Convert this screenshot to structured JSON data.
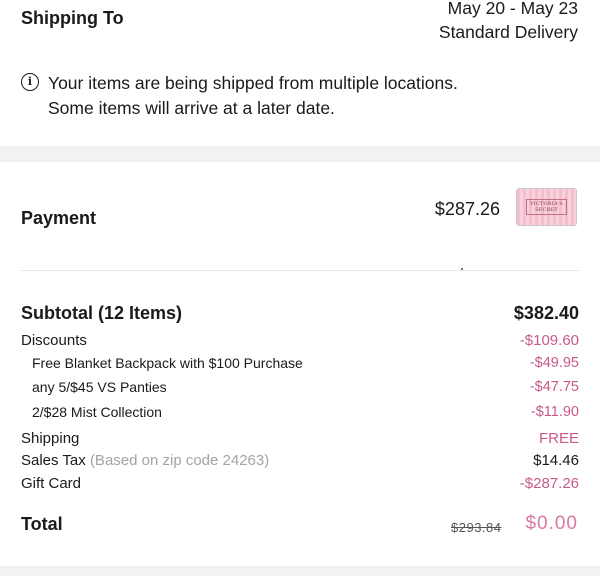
{
  "shipping": {
    "title": "Shipping To",
    "date_range": "May 20 - May 23",
    "method": "Standard Delivery",
    "notice_line1": "Your items are being shipped from multiple locations.",
    "notice_line2": "Some items will arrive at a later date."
  },
  "payment": {
    "title": "Payment",
    "amount": "$287.26",
    "card_brand_line1": "VICTORIA'S",
    "card_brand_line2": "SECRET"
  },
  "summary": {
    "subtotal_label": "Subtotal (12 Items)",
    "subtotal_value": "$382.40",
    "discounts_label": "Discounts",
    "discounts_value": "-$109.60",
    "promos": [
      {
        "label": "Free Blanket Backpack with $100 Purchase",
        "value": "-$49.95"
      },
      {
        "label": "any 5/$45 VS Panties",
        "value": "-$47.75"
      },
      {
        "label": "2/$28 Mist Collection",
        "value": "-$11.90"
      }
    ],
    "shipping_label": "Shipping",
    "shipping_value": "FREE",
    "tax_label": "Sales Tax",
    "tax_note": "(Based on zip code 24263)",
    "tax_value": "$14.46",
    "giftcard_label": "Gift Card",
    "giftcard_value": "-$287.26",
    "total_label": "Total",
    "total_original": "$293.84",
    "total_value": "$0.00"
  },
  "colors": {
    "accent_pink": "#c85a8a",
    "muted_gray": "#a4a4a4",
    "band_gray": "#f2f2f2"
  }
}
